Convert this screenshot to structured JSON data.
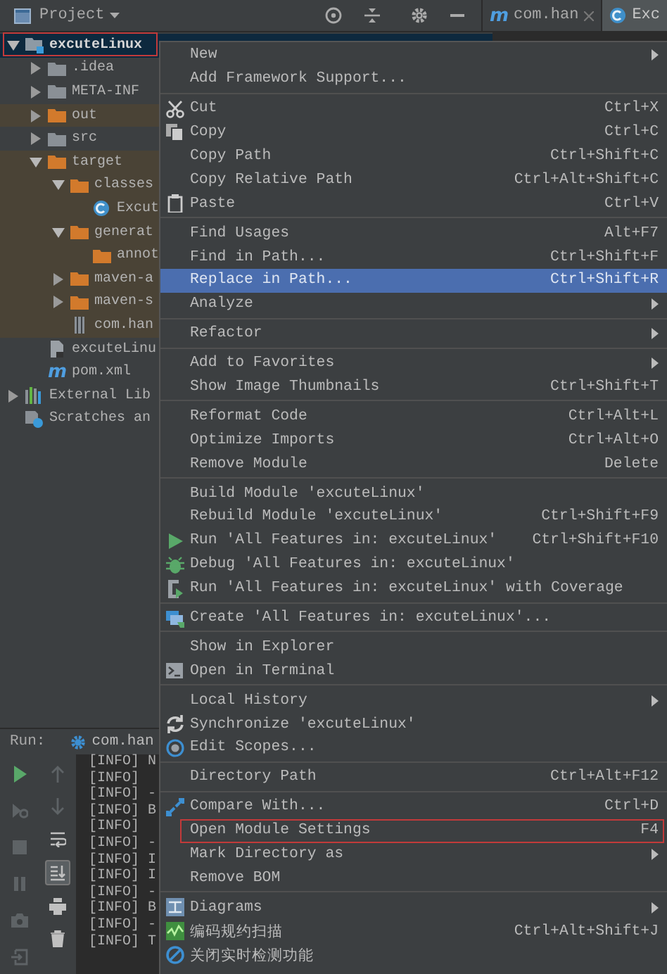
{
  "project": {
    "title": "Project",
    "toolbar": [
      {
        "kind": "locate"
      },
      {
        "kind": "collapse"
      },
      {
        "kind": "settings"
      },
      {
        "kind": "hide"
      }
    ],
    "tree": [
      {
        "label": "excuteLinux",
        "kind": "module",
        "expanded": true,
        "selected": true,
        "outlined": true,
        "excluded": false,
        "children": [
          {
            "label": ".idea",
            "kind": "folder",
            "expanded": false,
            "selected": false,
            "excluded": false
          },
          {
            "label": "META-INF",
            "kind": "folder",
            "expanded": false,
            "selected": false,
            "excluded": false
          },
          {
            "label": "out",
            "kind": "excluded-folder",
            "expanded": false,
            "selected": false,
            "excluded": true
          },
          {
            "label": "src",
            "kind": "folder",
            "expanded": false,
            "selected": false,
            "excluded": false
          },
          {
            "label": "target",
            "kind": "excluded-folder",
            "expanded": true,
            "selected": false,
            "excluded": true,
            "children": [
              {
                "label": "classes",
                "kind": "excluded-folder",
                "expanded": true,
                "selected": false,
                "excluded": true,
                "children": [
                  {
                    "label": "Excut",
                    "kind": "class",
                    "selected": false,
                    "excluded": true
                  }
                ]
              },
              {
                "label": "generat",
                "kind": "excluded-folder",
                "expanded": true,
                "selected": false,
                "excluded": true,
                "children": [
                  {
                    "label": "annot",
                    "kind": "excluded-folder",
                    "selected": false,
                    "excluded": true
                  }
                ]
              },
              {
                "label": "maven-a",
                "kind": "excluded-folder",
                "expanded": false,
                "selected": false,
                "excluded": true
              },
              {
                "label": "maven-s",
                "kind": "excluded-folder",
                "expanded": false,
                "selected": false,
                "excluded": true
              },
              {
                "label": "com.han",
                "kind": "jar",
                "selected": false,
                "excluded": true
              }
            ]
          },
          {
            "label": "excuteLinu",
            "kind": "iml",
            "selected": false,
            "excluded": false
          },
          {
            "label": "pom.xml",
            "kind": "maven",
            "icon_char": "m",
            "selected": false,
            "excluded": false
          }
        ]
      },
      {
        "label": "External Lib",
        "kind": "library",
        "expanded": false,
        "selected": false,
        "excluded": false
      },
      {
        "label": "Scratches an",
        "kind": "scratches",
        "selected": false,
        "excluded": false
      }
    ]
  },
  "editor_tabs": [
    {
      "label": "com.han",
      "kind": "maven",
      "icon_char": "m",
      "closable": true,
      "selected": false
    },
    {
      "label": "Exc",
      "kind": "class",
      "closable": false,
      "selected": true
    }
  ],
  "menu": {
    "groups": [
      {
        "items": [
          {
            "label": "New",
            "kind": "none",
            "submenu": true,
            "selected": false
          },
          {
            "label": "Add Framework Support...",
            "kind": "none",
            "submenu": false,
            "selected": false
          }
        ]
      },
      {
        "items": [
          {
            "label": "Cut",
            "shortcut": "Ctrl+X",
            "kind": "scissors",
            "submenu": false,
            "selected": false
          },
          {
            "label": "Copy",
            "shortcut": "Ctrl+C",
            "kind": "copy",
            "submenu": false,
            "selected": false
          },
          {
            "label": "Copy Path",
            "shortcut": "Ctrl+Shift+C",
            "kind": "none",
            "submenu": false,
            "selected": false
          },
          {
            "label": "Copy Relative Path",
            "shortcut": "Ctrl+Alt+Shift+C",
            "kind": "none",
            "submenu": false,
            "selected": false
          },
          {
            "label": "Paste",
            "shortcut": "Ctrl+V",
            "kind": "paste",
            "submenu": false,
            "selected": false
          }
        ]
      },
      {
        "items": [
          {
            "label": "Find Usages",
            "shortcut": "Alt+F7",
            "kind": "none",
            "submenu": false,
            "selected": false
          },
          {
            "label": "Find in Path...",
            "shortcut": "Ctrl+Shift+F",
            "kind": "none",
            "submenu": false,
            "selected": false
          },
          {
            "label": "Replace in Path...",
            "shortcut": "Ctrl+Shift+R",
            "kind": "none",
            "submenu": false,
            "selected": true
          },
          {
            "label": "Analyze",
            "kind": "none",
            "submenu": true,
            "selected": false
          }
        ]
      },
      {
        "items": [
          {
            "label": "Refactor",
            "kind": "none",
            "submenu": true,
            "selected": false
          }
        ]
      },
      {
        "items": [
          {
            "label": "Add to Favorites",
            "kind": "none",
            "submenu": true,
            "selected": false
          },
          {
            "label": "Show Image Thumbnails",
            "shortcut": "Ctrl+Shift+T",
            "kind": "none",
            "submenu": false,
            "selected": false
          }
        ]
      },
      {
        "items": [
          {
            "label": "Reformat Code",
            "shortcut": "Ctrl+Alt+L",
            "kind": "none",
            "submenu": false,
            "selected": false
          },
          {
            "label": "Optimize Imports",
            "shortcut": "Ctrl+Alt+O",
            "kind": "none",
            "submenu": false,
            "selected": false
          },
          {
            "label": "Remove Module",
            "shortcut": "Delete",
            "kind": "none",
            "submenu": false,
            "selected": false
          }
        ]
      },
      {
        "items": [
          {
            "label": "Build Module 'excuteLinux'",
            "kind": "none",
            "submenu": false,
            "selected": false
          },
          {
            "label": "Rebuild Module 'excuteLinux'",
            "shortcut": "Ctrl+Shift+F9",
            "kind": "none",
            "submenu": false,
            "selected": false
          },
          {
            "label": "Run 'All Features in: excuteLinux'",
            "shortcut": "Ctrl+Shift+F10",
            "kind": "run",
            "submenu": false,
            "selected": false
          },
          {
            "label": "Debug 'All Features in: excuteLinux'",
            "kind": "debug",
            "submenu": false,
            "selected": false
          },
          {
            "label": "Run 'All Features in: excuteLinux' with Coverage",
            "kind": "coverage",
            "submenu": false,
            "selected": false
          }
        ]
      },
      {
        "items": [
          {
            "label": "Create 'All Features in: excuteLinux'...",
            "kind": "create",
            "submenu": false,
            "selected": false
          }
        ]
      },
      {
        "items": [
          {
            "label": "Show in Explorer",
            "kind": "none",
            "submenu": false,
            "selected": false
          },
          {
            "label": "Open in Terminal",
            "kind": "terminal",
            "submenu": false,
            "selected": false
          }
        ]
      },
      {
        "items": [
          {
            "label": "Local History",
            "kind": "none",
            "submenu": true,
            "selected": false
          },
          {
            "label": "Synchronize 'excuteLinux'",
            "kind": "sync",
            "submenu": false,
            "selected": false
          },
          {
            "label": "Edit Scopes...",
            "kind": "scopes",
            "submenu": false,
            "selected": false
          }
        ]
      },
      {
        "items": [
          {
            "label": "Directory Path",
            "shortcut": "Ctrl+Alt+F12",
            "kind": "none",
            "submenu": false,
            "selected": false
          }
        ]
      },
      {
        "items": [
          {
            "label": "Compare With...",
            "shortcut": "Ctrl+D",
            "kind": "compare",
            "submenu": false,
            "selected": false
          },
          {
            "label": "Open Module Settings",
            "shortcut": "F4",
            "kind": "none",
            "submenu": false,
            "selected": false,
            "outlined": true
          },
          {
            "label": "Mark Directory as",
            "kind": "none",
            "submenu": true,
            "selected": false
          },
          {
            "label": "Remove BOM",
            "kind": "none",
            "submenu": false,
            "selected": false
          }
        ]
      },
      {
        "items": [
          {
            "label": "Diagrams",
            "kind": "diagrams",
            "submenu": true,
            "selected": false
          },
          {
            "label": "编码规约扫描",
            "shortcut": "Ctrl+Alt+Shift+J",
            "kind": "scan",
            "submenu": false,
            "selected": false
          },
          {
            "label": "关闭实时检测功能",
            "kind": "disable",
            "submenu": false,
            "selected": false
          }
        ]
      }
    ]
  },
  "run": {
    "label": "Run:",
    "tab": "com.han",
    "left_tools": [
      {
        "kind": "run",
        "disabled": false,
        "selected": false
      },
      {
        "kind": "rerun",
        "disabled": true,
        "selected": false
      },
      {
        "kind": "stop",
        "disabled": true,
        "selected": false
      },
      {
        "kind": "pause",
        "disabled": true,
        "selected": false
      },
      {
        "kind": "camera",
        "disabled": true,
        "selected": false
      },
      {
        "kind": "exit",
        "disabled": true,
        "selected": false
      }
    ],
    "right_tools": [
      {
        "kind": "up",
        "disabled": true,
        "selected": false
      },
      {
        "kind": "down",
        "disabled": true,
        "selected": false
      },
      {
        "kind": "wrap",
        "disabled": false,
        "selected": false
      },
      {
        "kind": "scroll-end",
        "disabled": false,
        "selected": true
      },
      {
        "kind": "print",
        "disabled": false,
        "selected": false
      },
      {
        "kind": "trash",
        "disabled": false,
        "selected": false
      }
    ],
    "console": [
      "[INFO] N",
      "[INFO]",
      "[INFO] -",
      "[INFO] B",
      "[INFO]",
      "[INFO] -",
      "[INFO] I",
      "[INFO] I",
      "[INFO] -",
      "[INFO] B",
      "[INFO] -",
      "[INFO] T"
    ]
  }
}
